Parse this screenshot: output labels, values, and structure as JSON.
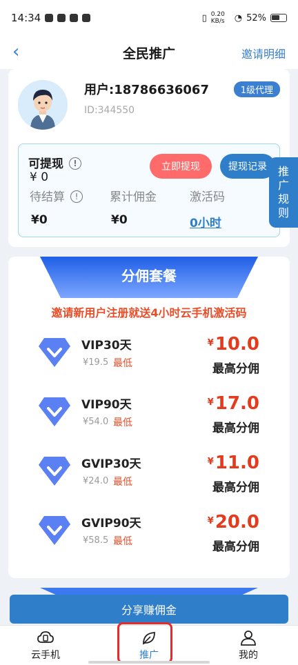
{
  "status_bar": {
    "time": "14:34",
    "speed": "0.20 KB/s",
    "battery": "52%"
  },
  "nav": {
    "title": "全民推广",
    "right_link": "邀请明细"
  },
  "profile": {
    "user": "用户:18786636067",
    "id": "ID:344550",
    "badge": "1级代理"
  },
  "wallet": {
    "withdrawable_label": "可提现",
    "withdrawable_amount": "¥ 0",
    "withdraw_button": "立即提现",
    "records_button": "提现记录",
    "stats": [
      {
        "label": "待结算",
        "value": "¥0"
      },
      {
        "label": "累计佣金",
        "value": "¥0"
      },
      {
        "label": "激活码",
        "value": "0小时"
      }
    ]
  },
  "side_tab": "推广规则",
  "packages": {
    "banner": "分佣套餐",
    "promo": "邀请新用户注册就送4小时云手机激活码",
    "items": [
      {
        "name": "VIP30天",
        "original": "¥19.5",
        "low_label": "最低",
        "price": "10.0",
        "currency": "¥",
        "max_label": "最高分佣"
      },
      {
        "name": "VIP90天",
        "original": "¥54.0",
        "low_label": "最低",
        "price": "17.0",
        "currency": "¥",
        "max_label": "最高分佣"
      },
      {
        "name": "GVIP30天",
        "original": "¥24.0",
        "low_label": "最低",
        "price": "11.0",
        "currency": "¥",
        "max_label": "最高分佣"
      },
      {
        "name": "GVIP90天",
        "original": "¥58.5",
        "low_label": "最低",
        "price": "20.0",
        "currency": "¥",
        "max_label": "最高分佣"
      }
    ]
  },
  "share_button": "分享赚佣金",
  "tabbar": {
    "items": [
      {
        "label": "云手机",
        "icon": "cloud-icon"
      },
      {
        "label": "推广",
        "icon": "leaf-icon"
      },
      {
        "label": "我的",
        "icon": "person-icon"
      }
    ],
    "active": "推广"
  },
  "colors": {
    "accent": "#2f7ec9",
    "price": "#e43b1f",
    "promo": "#e94d28",
    "withdraw": "#ff6b6b",
    "highlight": "#e52b2b"
  }
}
